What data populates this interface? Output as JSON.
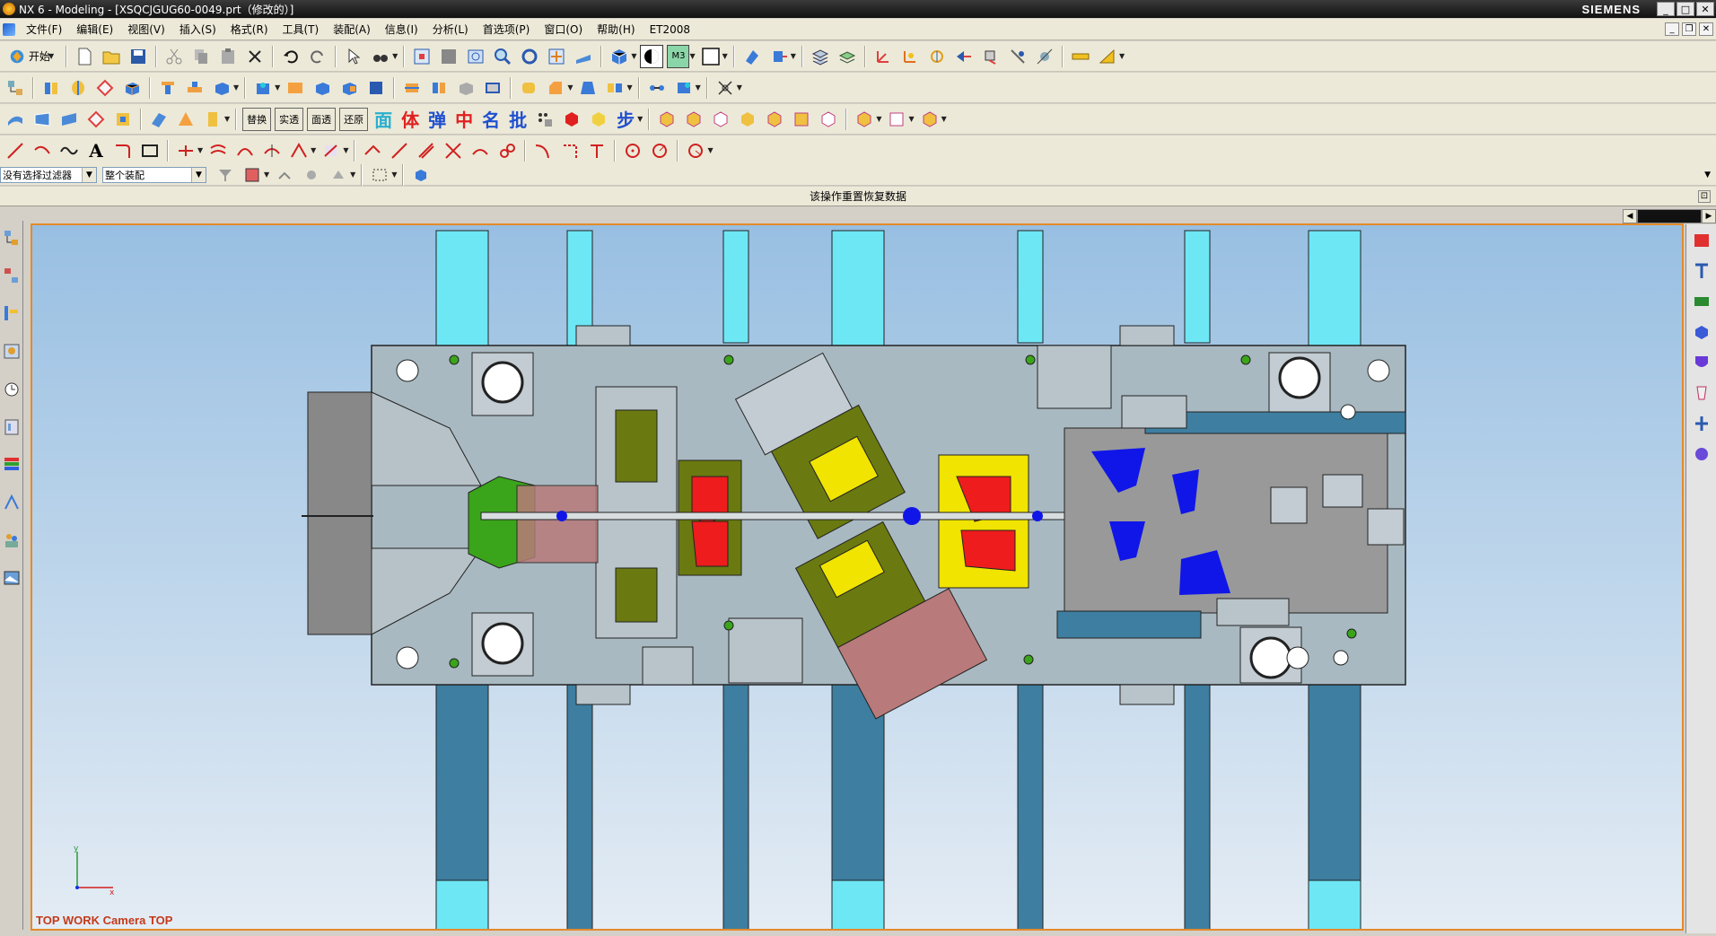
{
  "window": {
    "title": "NX 6 - Modeling - [XSQCJGUG60-0049.prt（修改的）]",
    "brand": "SIEMENS",
    "minimize": "_",
    "maximize": "□",
    "close": "✕"
  },
  "menu": {
    "items": [
      "文件(F)",
      "编辑(E)",
      "视图(V)",
      "插入(S)",
      "格式(R)",
      "工具(T)",
      "装配(A)",
      "信息(I)",
      "分析(L)",
      "首选项(P)",
      "窗口(O)",
      "帮助(H)",
      "ET2008"
    ]
  },
  "toolbar1": {
    "start_label": "开始"
  },
  "toolbar2": {
    "render_mode": "M3"
  },
  "toolbar3": {
    "replace": "替换",
    "solid": "实透",
    "face": "面透",
    "restore": "还原",
    "glyph_mian": "面",
    "glyph_ti": "体",
    "glyph_tan": "弹",
    "glyph_zhong": "中",
    "glyph_ming": "名",
    "glyph_pi": "批",
    "glyph_bu": "步"
  },
  "selection": {
    "filter_value": "没有选择过滤器",
    "scope_value": "整个装配"
  },
  "status": {
    "message": "该操作重置恢复数据"
  },
  "graphics": {
    "view_label": "TOP WORK Camera TOP",
    "axis_x": "x",
    "axis_y": "y",
    "background_top": "#98bfe2",
    "border_color": "#e48a2a"
  },
  "colors": {
    "plate": "#a9b9c1",
    "clamp_green": "#3aa51a",
    "olive": "#6a7a10",
    "red": "#ee1c1c",
    "yellow": "#f0e400",
    "blue": "#1016e8",
    "brown": "#b87a7a",
    "cyan": "#6ee7f5",
    "steel_blue": "#3e7ea0"
  }
}
